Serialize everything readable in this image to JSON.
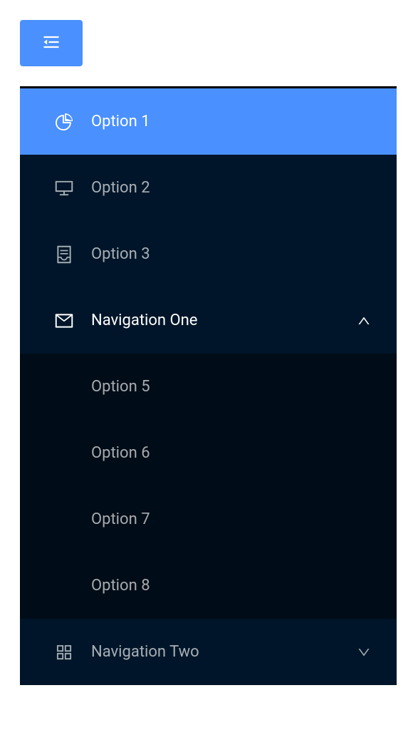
{
  "menu": {
    "items": [
      {
        "label": "Option 1",
        "icon": "pie-chart",
        "active": true
      },
      {
        "label": "Option 2",
        "icon": "desktop",
        "active": false
      },
      {
        "label": "Option 3",
        "icon": "container",
        "active": false
      }
    ],
    "submenus": [
      {
        "label": "Navigation One",
        "icon": "mail",
        "expanded": true,
        "children": [
          {
            "label": "Option 5"
          },
          {
            "label": "Option 6"
          },
          {
            "label": "Option 7"
          },
          {
            "label": "Option 8"
          }
        ]
      },
      {
        "label": "Navigation Two",
        "icon": "appstore",
        "expanded": false
      }
    ]
  }
}
